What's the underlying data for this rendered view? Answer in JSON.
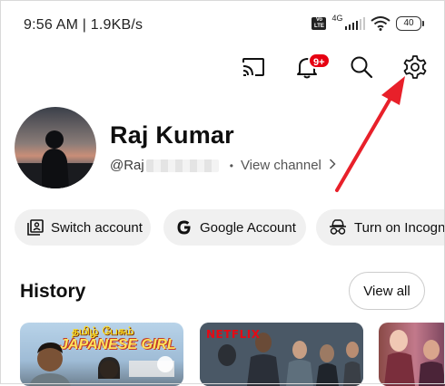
{
  "status_bar": {
    "time": "9:56 AM | 1.9KB/s",
    "volte_label": "Vo LTE",
    "network_type": "4G",
    "battery_level": "40"
  },
  "toolbar": {
    "notification_count": "9+",
    "icons": [
      "cast-icon",
      "bell-icon",
      "search-icon",
      "gear-icon"
    ]
  },
  "profile": {
    "name": "Raj Kumar",
    "handle_prefix": "@Raj",
    "separator": "•",
    "view_channel_label": "View channel"
  },
  "chips": [
    {
      "label": "Switch account",
      "icon": "switch-account-icon"
    },
    {
      "label": "Google Account",
      "icon": "google-icon"
    },
    {
      "label": "Turn on Incognit",
      "icon": "incognito-icon"
    }
  ],
  "history": {
    "title": "History",
    "view_all_label": "View all",
    "thumbnails": [
      {
        "title_top": "தமிழ் பேசும்",
        "title_main": "JAPANESE GIRL"
      },
      {
        "logo": "NETFLIX"
      },
      {}
    ]
  },
  "colors": {
    "annotation_arrow": "#e8202a",
    "badge": "#e60012",
    "chip_background": "#f0f0f0"
  }
}
